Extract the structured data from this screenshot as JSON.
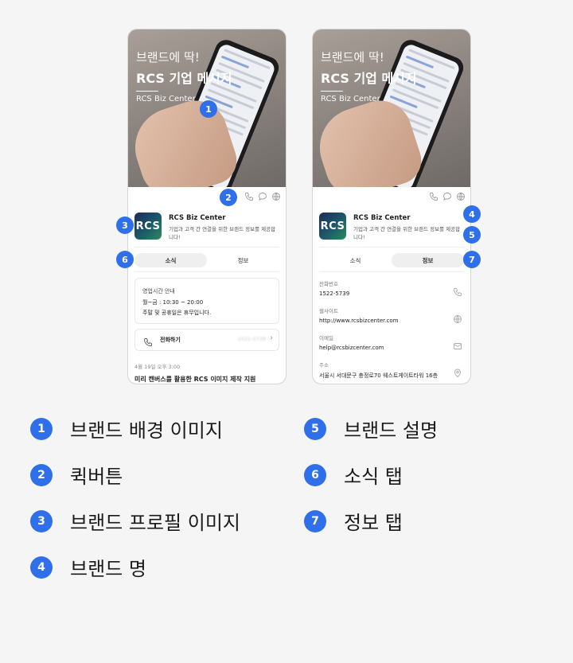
{
  "hero": {
    "line1": "브랜드에 딱!",
    "line2": "RCS 기업 메시지",
    "line3": "RCS Biz Center"
  },
  "brand": {
    "logo_text": "RCS",
    "name": "RCS Biz Center",
    "description": "기업과 고객 간 연결을 위한 브랜드 정보를 제공합니다!"
  },
  "tabs": {
    "news": "소식",
    "info": "정보"
  },
  "news_tab": {
    "hours_title": "영업시간 안내",
    "hours_line1": "월~금 : 10:30 ~ 20:00",
    "hours_line2": "주말 및 공휴일은 휴무입니다.",
    "call_label": "전화하기",
    "call_number": "1522-5739",
    "post_date": "4월 19일 오후 3:00",
    "post_title": "미리 캔버스를 활용한 RCS 이미지 제작 지원"
  },
  "info_tab": {
    "items": [
      {
        "label": "전화번호",
        "value": "1522-5739",
        "icon": "phone-icon"
      },
      {
        "label": "웹사이트",
        "value": "http://www.rcsbizcenter.com",
        "icon": "globe-icon"
      },
      {
        "label": "이메일",
        "value": "help@rcsbizcenter.com",
        "icon": "mail-icon"
      },
      {
        "label": "주소",
        "value": "서울시 서대문구 충정로70 웨스트게이트타워 16층",
        "icon": "location-pin-icon"
      }
    ]
  },
  "markers": {
    "m1": "1",
    "m2": "2",
    "m3": "3",
    "m4": "4",
    "m5": "5",
    "m6": "6",
    "m7": "7"
  },
  "legend": [
    {
      "num": "1",
      "text": "브랜드 배경 이미지"
    },
    {
      "num": "2",
      "text": "퀵버튼"
    },
    {
      "num": "3",
      "text": "브랜드 프로필 이미지"
    },
    {
      "num": "4",
      "text": "브랜드 명"
    },
    {
      "num": "5",
      "text": "브랜드 설명"
    },
    {
      "num": "6",
      "text": "소식 탭"
    },
    {
      "num": "7",
      "text": "정보 탭"
    }
  ],
  "colors": {
    "accent": "#2f6fe9",
    "background": "#f5f5f5"
  }
}
